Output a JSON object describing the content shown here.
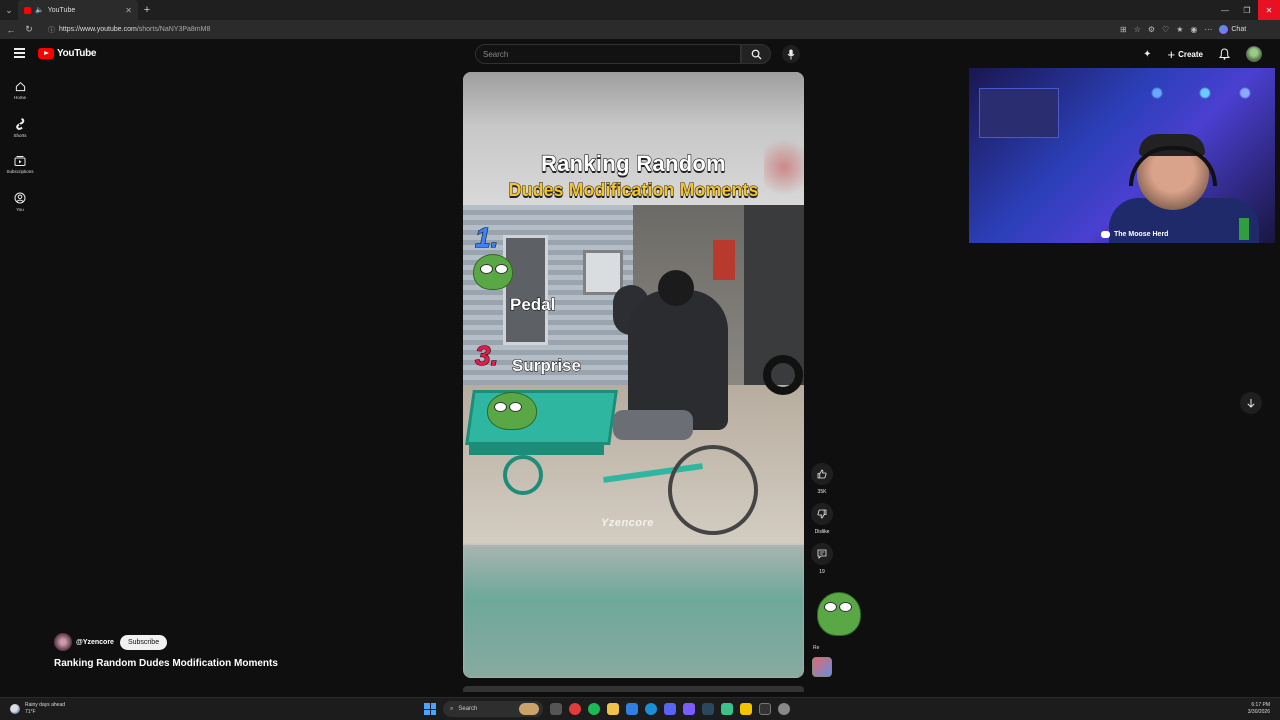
{
  "browser": {
    "tab_title": "YouTube",
    "url_host": "https://www.youtube.com",
    "url_path": "/shorts/NaNY3Pa8mM8",
    "chat_label": "Chat"
  },
  "youtube": {
    "logo_text": "YouTube",
    "search_placeholder": "Search",
    "create_label": "Create",
    "sidebar": [
      {
        "label": "Home",
        "icon": "home-icon"
      },
      {
        "label": "Shorts",
        "icon": "shorts-icon"
      },
      {
        "label": "Subscriptions",
        "icon": "subscriptions-icon"
      },
      {
        "label": "You",
        "icon": "you-icon"
      }
    ]
  },
  "short": {
    "title_line1": "Ranking Random",
    "title_line2": "Dudes Modification Moments",
    "rank1_number": "1.",
    "rank1_label": "Pedal",
    "rank3_number": "3.",
    "rank3_label": "Surprise",
    "watermark": "Yzencore",
    "channel_handle": "@Yzencore",
    "subscribe_label": "Subscribe",
    "video_title": "Ranking Random Dudes Modification Moments"
  },
  "actions": {
    "likes": "35K",
    "dislike_label": "Dislike",
    "comments": "19",
    "remix_label": "Re"
  },
  "webcam": {
    "discord_name": "The Moose Herd"
  },
  "taskbar": {
    "weather_line1": "Rainy days ahead",
    "weather_line2": "71°F",
    "search_label": "Search",
    "time": "6:17 PM",
    "date": "3/30/2026"
  },
  "colors": {
    "yt_red": "#ff0000",
    "title_yellow": "#f4c430",
    "rank1_blue": "#3b82f6",
    "rank3_red": "#e11d48"
  }
}
